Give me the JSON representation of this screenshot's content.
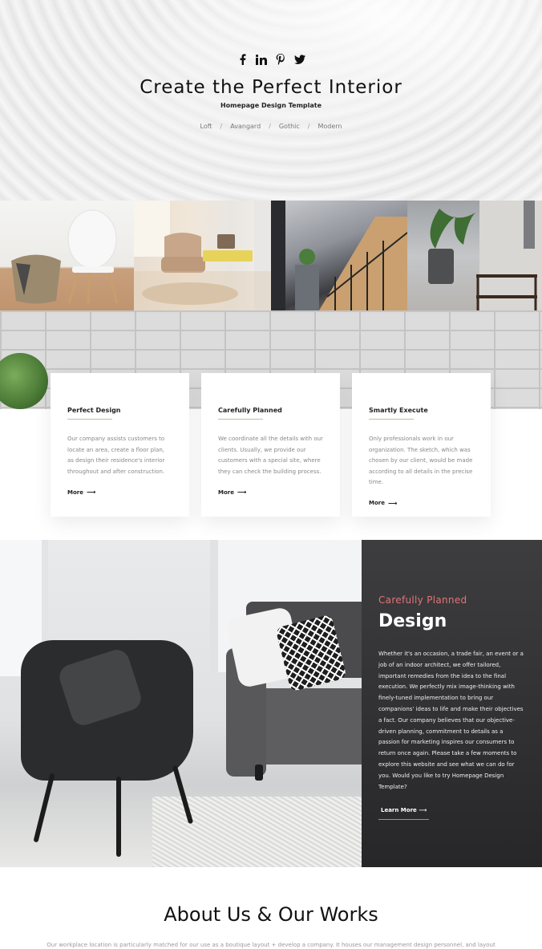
{
  "hero": {
    "title": "Create the Perfect Interior",
    "subtitle": "Homepage Design Template",
    "nav": [
      "Loft",
      "Avangard",
      "Gothic",
      "Modern"
    ],
    "separator": "/",
    "socials": [
      "facebook-icon",
      "linkedin-icon",
      "pinterest-icon",
      "twitter-icon"
    ]
  },
  "cards": [
    {
      "title": "Perfect Design",
      "text": "Our company assists customers to locate an area, create a floor plan, as design their residence's interior throughout and after construction.",
      "more": "More"
    },
    {
      "title": "Carefully Planned",
      "text": "We coordinate all the details with our clients. Usually, we provide our customers with a special site, where they can check the building process.",
      "more": "More"
    },
    {
      "title": "Smartly Execute",
      "text": "Only professionals work in our organization. The sketch, which was chosen by our client, would be made according to all details in the precise time.",
      "more": "More"
    }
  ],
  "design": {
    "kicker": "Carefully Planned",
    "title": "Design",
    "text": "Whether it's an occasion, a trade fair, an event or a job of an indoor architect, we offer tailored, important remedies from the idea to the final execution. We perfectly mix image-thinking with finely-tuned implementation to bring our companions' ideas to life and make their objectives a fact. Our company believes that our objective-driven planning, commitment to details as a passion for marketing inspires our consumers to return once again. Please take a few moments to explore this website and see what we can do for you. Would you like to try Homepage Design Template?",
    "button": "Learn More"
  },
  "about": {
    "title": "About Us & Our Works",
    "text": "Our workplace location is particularly matched for our use as a boutique layout + develop a company. It houses our management design personnel, and layout"
  },
  "colors": {
    "accent": "#e0757a",
    "panel": "#2d2d2f"
  }
}
